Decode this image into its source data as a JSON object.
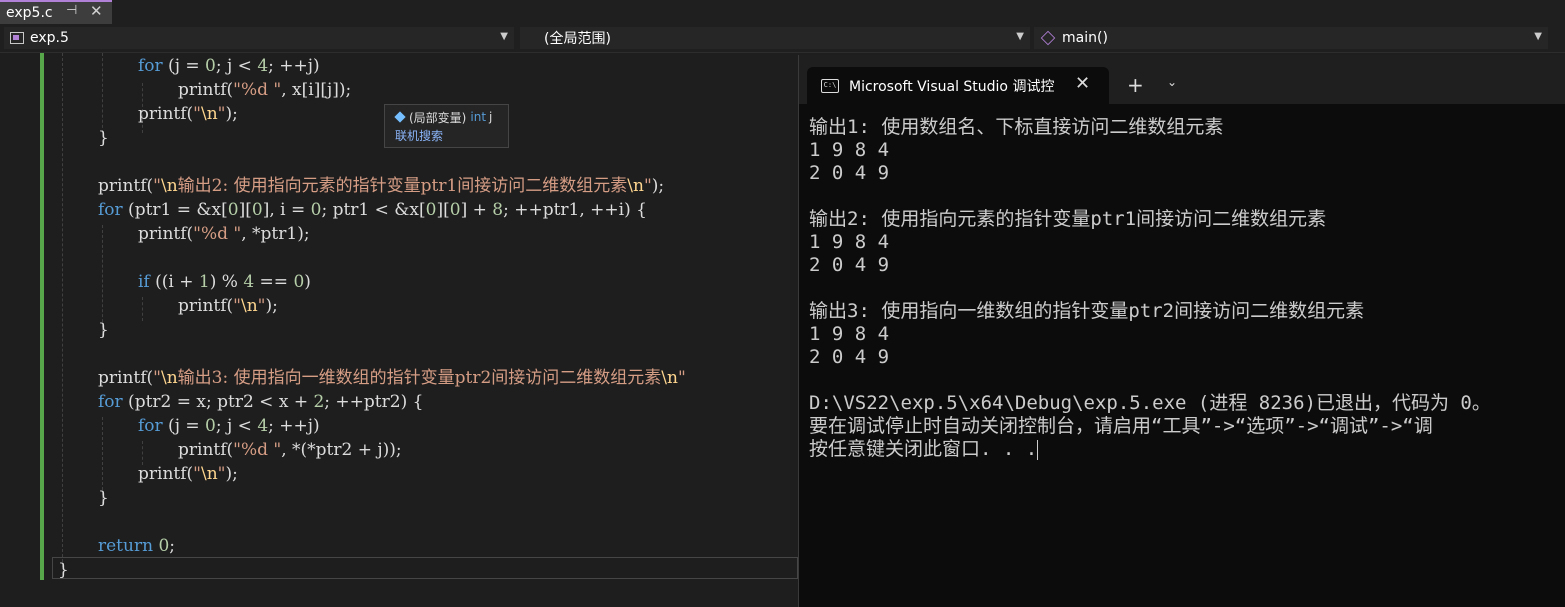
{
  "tab": {
    "filename": "exp5.c",
    "pin_glyph": "⊣",
    "close_glyph": "✕"
  },
  "navbar": {
    "project": "exp.5",
    "scope": "(全局范围)",
    "member": "main()"
  },
  "tooltip": {
    "kind": "(局部变量)",
    "type": "int",
    "name": "j",
    "link": "联机搜索"
  },
  "terminal": {
    "tab_title": "Microsoft Visual Studio 调试控制台",
    "icon_text": "C:\\",
    "close_glyph": "✕",
    "add_glyph": "+",
    "dropdown_glyph": "⌄",
    "lines": [
      "输出1: 使用数组名、下标直接访问二维数组元素",
      "1 9 8 4",
      "2 0 4 9",
      "",
      "输出2: 使用指向元素的指针变量ptr1间接访问二维数组元素",
      "1 9 8 4",
      "2 0 4 9",
      "",
      "输出3: 使用指向一维数组的指针变量ptr2间接访问二维数组元素",
      "1 9 8 4",
      "2 0 4 9",
      "",
      "D:\\VS22\\exp.5\\x64\\Debug\\exp.5.exe (进程 8236)已退出，代码为 0。",
      "要在调试停止时自动关闭控制台，请启用“工具”->“选项”->“调试”->“调",
      "按任意键关闭此窗口. . ."
    ]
  },
  "code": {
    "l1": [
      "for",
      " (j = ",
      "0",
      "; j < ",
      "4",
      "; ++j)"
    ],
    "l2": [
      "printf(",
      "\"%d \"",
      ", x[i][j]);"
    ],
    "l3": [
      "printf(",
      "\"",
      "\\n",
      "\"",
      ");"
    ],
    "l4": "}",
    "l5": [
      "printf(",
      "\"",
      "\\n",
      "输出2: 使用指向元素的指针变量ptr1间接访问二维数组元素",
      "\\n",
      "\"",
      ");"
    ],
    "l6": [
      "for",
      " (ptr1 = &x[",
      "0",
      "][",
      "0",
      "], i = ",
      "0",
      "; ptr1 < &x[",
      "0",
      "][",
      "0",
      "] + ",
      "8",
      "; ++ptr1, ++i) {"
    ],
    "l7": [
      "printf(",
      "\"%d \"",
      ", *ptr1);"
    ],
    "l8": [
      "if",
      " ((i + ",
      "1",
      ") % ",
      "4",
      " == ",
      "0",
      ")"
    ],
    "l9": [
      "printf(",
      "\"",
      "\\n",
      "\"",
      ");"
    ],
    "l10": "}",
    "l11": [
      "printf(",
      "\"",
      "\\n",
      "输出3: 使用指向一维数组的指针变量ptr2间接访问二维数组元素",
      "\\n",
      "\""
    ],
    "l12": [
      "for",
      " (ptr2 = x; ptr2 < x + ",
      "2",
      "; ++ptr2) {"
    ],
    "l13": [
      "for",
      " (j = ",
      "0",
      "; j < ",
      "4",
      "; ++j)"
    ],
    "l14": [
      "printf(",
      "\"%d \"",
      ", *(*ptr2 + j));"
    ],
    "l15": [
      "printf(",
      "\"",
      "\\n",
      "\"",
      ");"
    ],
    "l16": "}",
    "l17": [
      "return",
      " ",
      "0",
      ";"
    ],
    "l18": "}"
  },
  "colors": {
    "keyword": "#569cd6",
    "string": "#d69d85",
    "escape": "#ffd68f",
    "number": "#b5cea8",
    "change_bar": "#57a64a",
    "accent": "#b180d7"
  }
}
